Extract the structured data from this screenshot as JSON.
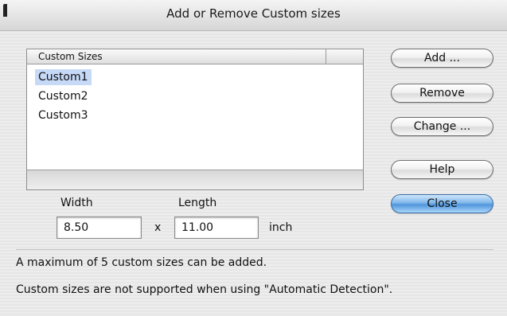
{
  "dialog": {
    "title": "Add or Remove Custom sizes"
  },
  "list": {
    "header": "Custom Sizes",
    "items": [
      {
        "label": "Custom1",
        "selected": true
      },
      {
        "label": "Custom2",
        "selected": false
      },
      {
        "label": "Custom3",
        "selected": false
      }
    ]
  },
  "buttons": {
    "add": "Add ...",
    "remove": "Remove",
    "change": "Change ...",
    "help": "Help",
    "close": "Close"
  },
  "size": {
    "width_label": "Width",
    "length_label": "Length",
    "width_value": "8.50",
    "length_value": "11.00",
    "times": "x",
    "unit": "inch"
  },
  "messages": {
    "max_note": "A maximum of 5 custom sizes can be added.",
    "auto_note": "Custom sizes are not supported when using \"Automatic Detection\"."
  },
  "colors": {
    "selection": "#c6d9f7",
    "default_button": "#5b9fe0"
  }
}
